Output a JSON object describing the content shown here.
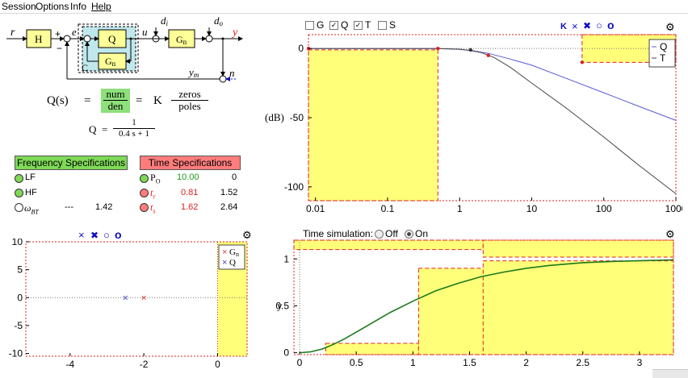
{
  "menu": {
    "items": [
      {
        "label": "Session"
      },
      {
        "label": "Options"
      },
      {
        "label": "Info"
      },
      {
        "label": "Help"
      }
    ]
  },
  "block_diagram": {
    "signals": {
      "r": "r",
      "e": "e",
      "u": "u",
      "di": "d",
      "di_sub": "i",
      "do": "d",
      "do_sub": "o",
      "y": "y",
      "n": "n",
      "ym": "y",
      "ym_sub": "m"
    },
    "blocks": {
      "h": "H",
      "q": "Q",
      "gn": "G",
      "gn_sub": "n",
      "gn2": "G",
      "gn2_sub": "n",
      "c": "C"
    },
    "signs": {
      "plus1": "+",
      "minus1": "−"
    }
  },
  "equations": {
    "qs_lhs": "Q(s)",
    "eq1": "=",
    "num": "num",
    "den": "den",
    "eq2": "=",
    "k": "K",
    "zeros": "zeros",
    "poles": "poles",
    "q_lhs": "Q",
    "q_eq": "=",
    "q_num": "1",
    "q_den": "0.4 s + 1"
  },
  "specs": {
    "freq_button": "Frequency Specifications",
    "time_button": "Time Specifications",
    "freq_rows": [
      {
        "label": "LF",
        "dash": "",
        "value": ""
      },
      {
        "label": "HF",
        "dash": "",
        "value": ""
      },
      {
        "label": "ω",
        "sub": "BT",
        "dash": "---",
        "value": "1.42"
      }
    ],
    "time_rows": [
      {
        "label": "P",
        "sub": "O",
        "spec": "10.00",
        "value": "0"
      },
      {
        "label": "t",
        "sub": "r",
        "spec": "0.81",
        "value": "1.52"
      },
      {
        "label": "t",
        "sub": "s",
        "spec": "1.62",
        "value": "2.64"
      }
    ],
    "colors": {
      "freq_button": "#7ed957",
      "time_button": "#ff7c7c",
      "green_text": "#1a9a1a",
      "red_text": "#e02020"
    }
  },
  "bode": {
    "checkboxes": [
      {
        "label": "G",
        "checked": false
      },
      {
        "label": "Q",
        "checked": true
      },
      {
        "label": "T",
        "checked": true
      },
      {
        "label": "S",
        "checked": false
      }
    ],
    "markers": [
      "K",
      "×",
      "✖",
      "○",
      "o"
    ],
    "ylabel": "(dB)",
    "legend": [
      "Q",
      "T"
    ]
  },
  "pz": {
    "markers": [
      "×",
      "✖",
      "○",
      "o"
    ],
    "legend": [
      "G",
      "Q"
    ],
    "legend_sub": "n"
  },
  "time_sim": {
    "label": "Time simulation:",
    "off": "Off",
    "on": "On",
    "ylabel": "y"
  },
  "chart_data": [
    {
      "type": "line",
      "title": "",
      "xlabel": "",
      "ylabel": "(dB)",
      "xscale": "log",
      "xlim": [
        0.008,
        1000
      ],
      "ylim": [
        -110,
        10
      ],
      "xticks": [
        0.01,
        0.1,
        1,
        10,
        100,
        1000
      ],
      "xtick_labels": [
        "0.01",
        "0.1",
        "1",
        "10",
        "100",
        "1000"
      ],
      "yticks": [
        0,
        -50,
        -100
      ],
      "ytick_labels": [
        "0",
        "-50",
        "-100"
      ],
      "grid": false,
      "legend": "top-right",
      "series": [
        {
          "name": "Q",
          "color": "#5a5ad8",
          "x": [
            0.008,
            0.1,
            0.5,
            1,
            1.5,
            2.5,
            5,
            10,
            30,
            100,
            300,
            1000
          ],
          "y": [
            0,
            0,
            -0.1,
            -0.6,
            -1.5,
            -3.5,
            -7.6,
            -12.1,
            -21.6,
            -32,
            -41.6,
            -52
          ]
        },
        {
          "name": "T",
          "color": "#444444",
          "x": [
            0.008,
            0.1,
            0.5,
            1,
            1.42,
            2,
            3,
            5,
            10,
            30,
            100,
            300,
            1000
          ],
          "y": [
            0,
            0,
            0,
            -0.5,
            -1.5,
            -3,
            -6.5,
            -13.5,
            -25,
            -43,
            -64,
            -84,
            -105
          ]
        }
      ],
      "spec_regions": [
        {
          "name": "LF",
          "x": [
            0.008,
            0.5
          ],
          "y": [
            -110,
            -1
          ]
        },
        {
          "name": "HF",
          "x": [
            50,
            1000
          ],
          "y": [
            -10,
            10
          ]
        }
      ],
      "points": [
        {
          "x": 0.008,
          "y": 0
        },
        {
          "x": 0.5,
          "y": 0
        },
        {
          "x": 1.42,
          "y": -1
        },
        {
          "x": 2.5,
          "y": -5
        },
        {
          "x": 50,
          "y": -10
        }
      ]
    },
    {
      "type": "scatter",
      "title": "",
      "xlabel": "",
      "ylabel": "",
      "xlim": [
        -5.2,
        0.8
      ],
      "ylim": [
        -10.5,
        10
      ],
      "xticks": [
        -4,
        -2,
        0
      ],
      "xtick_labels": [
        "-4",
        "-2",
        "0"
      ],
      "yticks": [
        10,
        5,
        0,
        -5,
        -10
      ],
      "ytick_labels": [
        "10",
        "5",
        "0",
        "-5",
        "-10"
      ],
      "legend": "top-right",
      "series": [
        {
          "name": "Gn",
          "marker": "×",
          "color": "#e04040",
          "x": [
            -2
          ],
          "y": [
            0
          ]
        },
        {
          "name": "Q",
          "marker": "×",
          "color": "#4040c0",
          "x": [
            -2.5
          ],
          "y": [
            0
          ]
        }
      ],
      "spec_regions": [
        {
          "name": "RHP",
          "x": [
            0,
            0.8
          ],
          "y": [
            -10.5,
            10
          ]
        }
      ]
    },
    {
      "type": "line",
      "title": "",
      "xlabel": "",
      "ylabel": "y",
      "xlim": [
        -0.05,
        3.3
      ],
      "ylim": [
        -0.02,
        1.2
      ],
      "xticks": [
        0,
        0.5,
        1,
        1.5,
        2,
        2.5,
        3
      ],
      "xtick_labels": [
        "0",
        "0.5",
        "1",
        "1.5",
        "2",
        "2.5",
        "3"
      ],
      "yticks": [
        0,
        0.5,
        1
      ],
      "ytick_labels": [
        "0",
        "0.5",
        "1"
      ],
      "series": [
        {
          "name": "y",
          "color": "#1a7a1a",
          "x": [
            0,
            0.1,
            0.2,
            0.3,
            0.4,
            0.5,
            0.6,
            0.8,
            1,
            1.2,
            1.4,
            1.6,
            1.8,
            2,
            2.2,
            2.5,
            2.8,
            3.3
          ],
          "y": [
            0,
            0.01,
            0.04,
            0.09,
            0.15,
            0.22,
            0.29,
            0.43,
            0.55,
            0.66,
            0.74,
            0.81,
            0.86,
            0.9,
            0.93,
            0.96,
            0.975,
            0.99
          ]
        }
      ],
      "spec_regions": [
        {
          "name": "upper",
          "x": [
            -0.05,
            1.62
          ],
          "y": [
            1.1,
            1.2
          ]
        },
        {
          "name": "upper2",
          "x": [
            1.62,
            3.3
          ],
          "y": [
            1.02,
            1.2
          ]
        },
        {
          "name": "lower1",
          "x": [
            0.23,
            1.05
          ],
          "y": [
            -0.02,
            0.1
          ]
        },
        {
          "name": "lower2",
          "x": [
            1.05,
            3.3
          ],
          "y": [
            -0.02,
            0.9
          ]
        },
        {
          "name": "lower3",
          "x": [
            1.62,
            3.3
          ],
          "y": [
            -0.02,
            0.98
          ]
        }
      ]
    }
  ]
}
